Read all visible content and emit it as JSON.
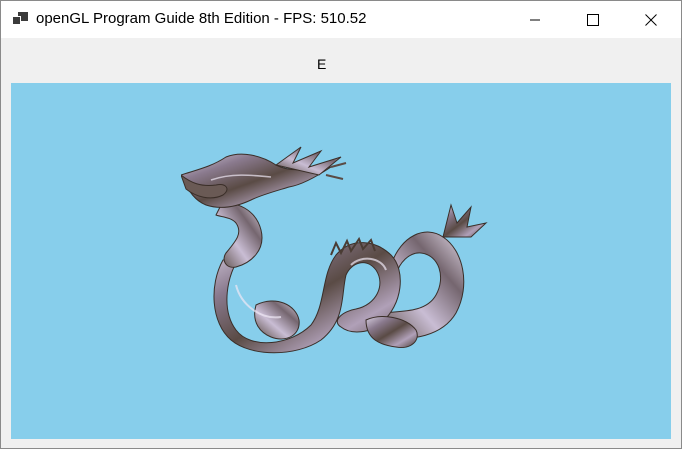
{
  "window": {
    "title": "openGL Program Guide 8th Edition - FPS: 510.52",
    "icon": "app-window-icon",
    "controls": {
      "minimize_icon": "minimize-icon",
      "maximize_icon": "maximize-icon",
      "close_icon": "close-icon"
    }
  },
  "menubar": {
    "label": "E"
  },
  "viewport": {
    "background_color": "#87ceeb",
    "model": "dragon-model"
  }
}
